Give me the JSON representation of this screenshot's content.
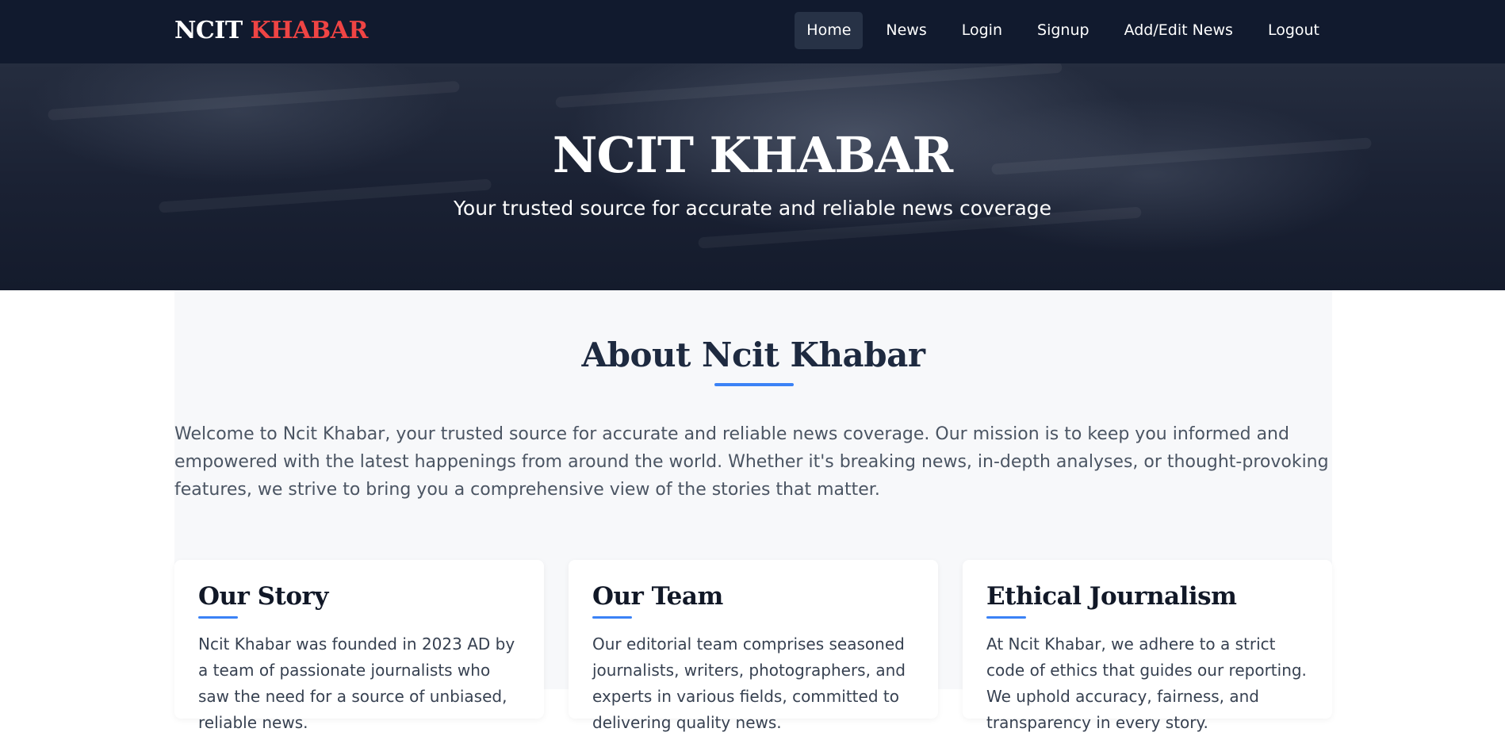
{
  "brand": {
    "part1": "NCIT",
    "part2": "KHABAR"
  },
  "nav": {
    "items": [
      {
        "label": "Home"
      },
      {
        "label": "News"
      },
      {
        "label": "Login"
      },
      {
        "label": "Signup"
      },
      {
        "label": "Add/Edit News"
      },
      {
        "label": "Logout"
      }
    ]
  },
  "hero": {
    "title": "NCIT KHABAR",
    "subtitle": "Your trusted source for accurate and reliable news coverage"
  },
  "about": {
    "title": "About Ncit Khabar",
    "text": "Welcome to Ncit Khabar, your trusted source for accurate and reliable news coverage. Our mission is to keep you informed and empowered with the latest happenings from around the world. Whether it's breaking news, in-depth analyses, or thought-provoking features, we strive to bring you a comprehensive view of the stories that matter."
  },
  "cards": [
    {
      "title": "Our Story",
      "text": "Ncit Khabar was founded in 2023 AD by a team of passionate journalists who saw the need for a source of unbiased, reliable news."
    },
    {
      "title": "Our Team",
      "text": "Our editorial team comprises seasoned journalists, writers, photographers, and experts in various fields, committed to delivering quality news."
    },
    {
      "title": "Ethical Journalism",
      "text": "At Ncit Khabar, we adhere to a strict code of ethics that guides our reporting. We uphold accuracy, fairness, and transparency in every story."
    }
  ],
  "colors": {
    "nav_bg": "#111a2e",
    "accent_red": "#ef4444",
    "accent_blue": "#3b82f6",
    "about_bg": "#f7f8fa"
  }
}
